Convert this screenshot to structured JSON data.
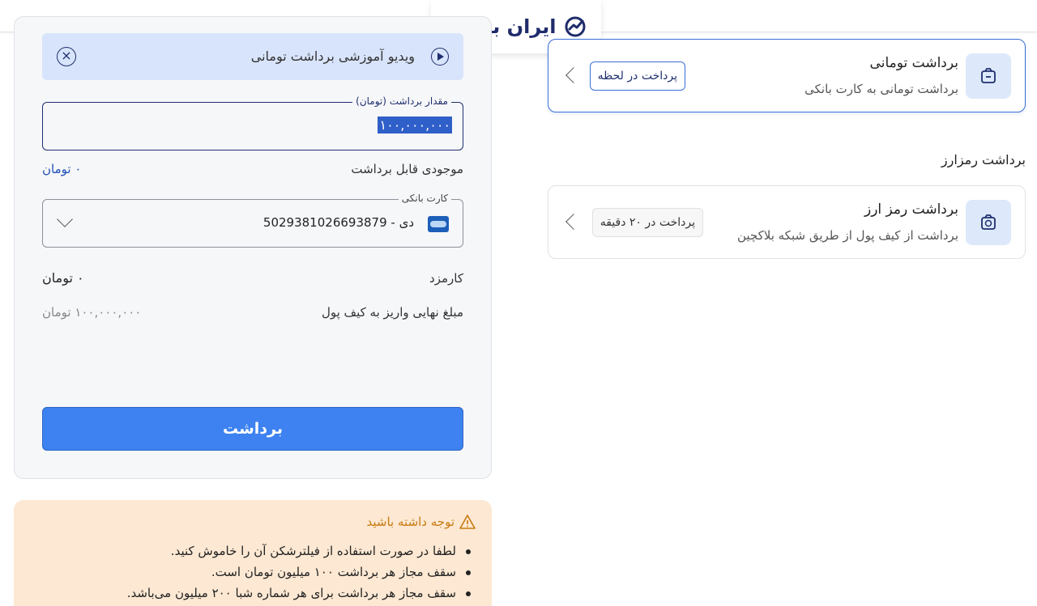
{
  "brand": {
    "logo_text": "ایران بروکر"
  },
  "video": {
    "title": "ویدیو آموزشی برداشت تومانی"
  },
  "amount": {
    "label": "مقدار برداشت (تومان)",
    "value": "۱۰۰,۰۰۰,۰۰۰"
  },
  "balance": {
    "label": "موجودی قابل برداشت",
    "value": "۰ تومان"
  },
  "bank_card": {
    "label": "کارت بانکی",
    "value": "دی - 5029381026693879"
  },
  "fee": {
    "label": "کارمزد",
    "value": "۰ تومان"
  },
  "final": {
    "label": "مبلغ نهایی واریز به کیف پول",
    "value": "۱۰۰,۰۰۰,۰۰۰ تومان"
  },
  "submit_label": "برداشت",
  "warning": {
    "title": "توجه داشته باشید",
    "items": [
      "لطفا در صورت استفاده از فیلترشکن آن را خاموش کنید.",
      "سقف مجاز هر برداشت ۱۰۰ میلیون تومان است.",
      "سقف مجاز هر برداشت برای هر شماره شبا ۲۰۰ میلیون می‌باشد."
    ]
  },
  "options": {
    "toman": {
      "title": "برداشت تومانی",
      "subtitle": "برداشت تومانی به کارت بانکی",
      "badge": "پرداخت در لحظه"
    },
    "crypto_heading": "برداشت رمزارز",
    "crypto": {
      "title": "برداشت رمز ارز",
      "subtitle": "برداشت از کیف پول از طریق شبکه بلاکچین",
      "badge": "پرداخت در ۲۰ دقیقه"
    }
  },
  "colors": {
    "primary": "#3d82f0",
    "navy": "#1f2f6e",
    "warning_bg": "#fde8d3",
    "warning_text": "#c77a10",
    "info_bg": "#d8e4fb"
  },
  "icons": [
    "logo-mark-icon",
    "play-icon",
    "close-circle-icon",
    "chevron-down-icon",
    "bank-card-icon",
    "warning-icon",
    "wallet-icon",
    "crypto-wallet-icon",
    "chevron-left-icon"
  ]
}
